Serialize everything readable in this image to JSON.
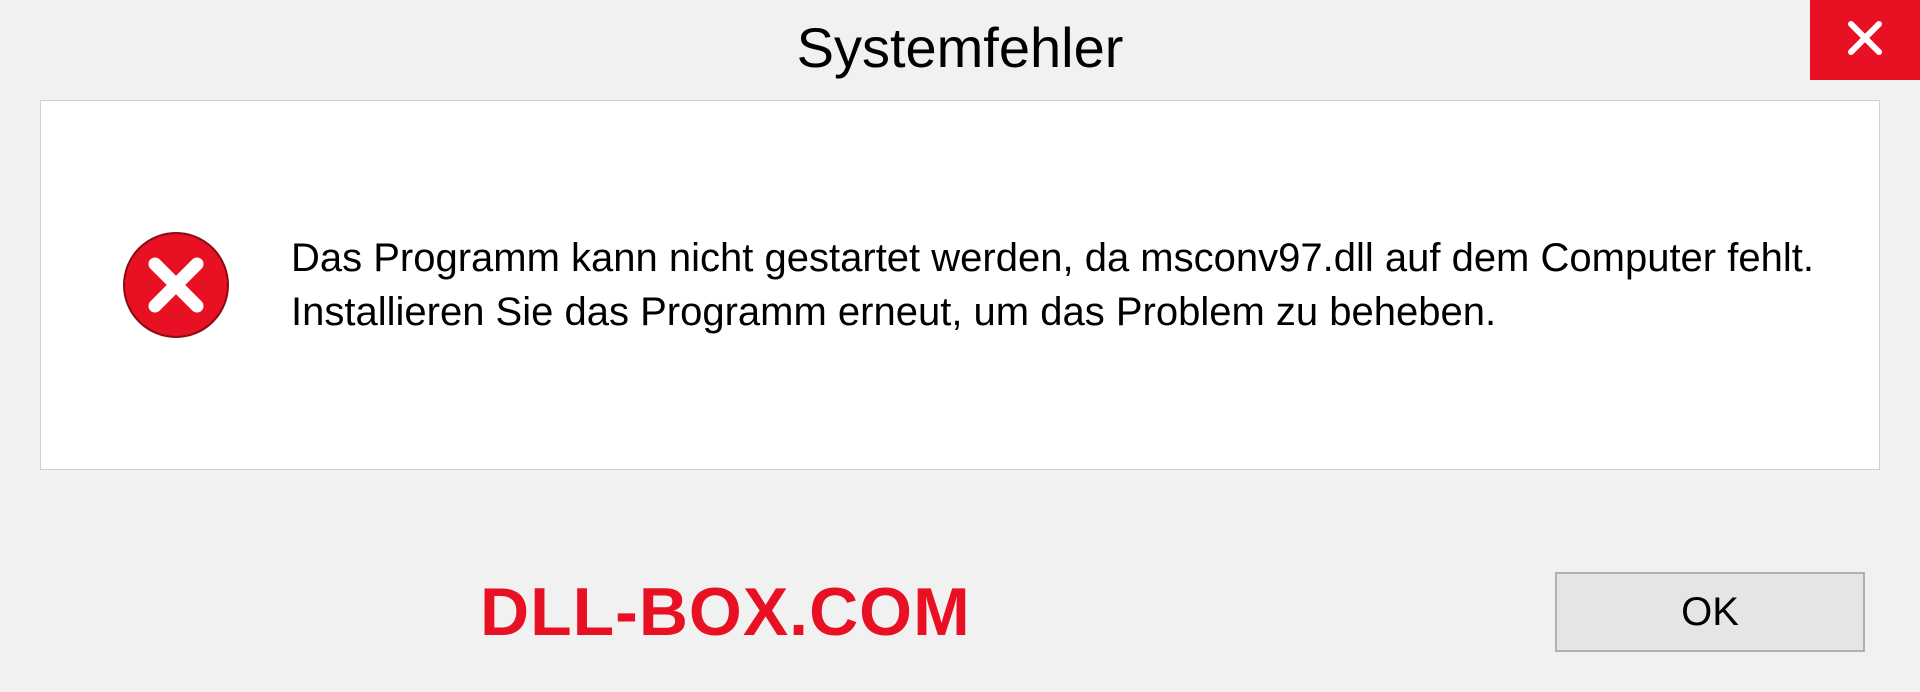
{
  "dialog": {
    "title": "Systemfehler",
    "message": "Das Programm kann nicht gestartet werden, da msconv97.dll auf dem Computer fehlt. Installieren Sie das Programm erneut, um das Problem zu beheben.",
    "ok_label": "OK"
  },
  "watermark": "DLL-BOX.COM"
}
